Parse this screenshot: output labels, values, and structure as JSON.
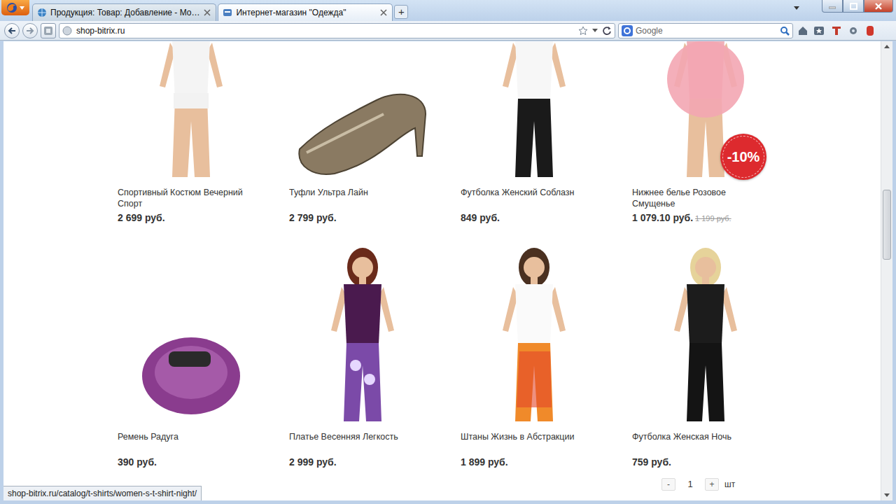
{
  "tabs": [
    {
      "label": "Продукция: Товар: Добавление - Мо…",
      "selected": false
    },
    {
      "label": "Интернет-магазин \"Одежда\"",
      "selected": true
    }
  ],
  "new_tab": "+",
  "address": "shop-bitrix.ru",
  "search": {
    "placeholder": "Google"
  },
  "products": [
    {
      "name": "Спортивный Костюм Вечерний Спорт",
      "price": "2 699 руб.",
      "old_price": "",
      "badge": ""
    },
    {
      "name": "Туфли Ультра Лайн",
      "price": "2 799 руб.",
      "old_price": "",
      "badge": ""
    },
    {
      "name": "Футболка Женский Соблазн",
      "price": "849 руб.",
      "old_price": "",
      "badge": ""
    },
    {
      "name": "Нижнее белье Розовое Смущенье",
      "price": "1 079.10 руб.",
      "old_price": "1 199 руб.",
      "badge": "-10%"
    },
    {
      "name": "Ремень Радуга",
      "price": "390 руб.",
      "old_price": "",
      "badge": ""
    },
    {
      "name": "Платье Весенняя Легкость",
      "price": "2 999 руб.",
      "old_price": "",
      "badge": ""
    },
    {
      "name": "Штаны Жизнь в Абстракции",
      "price": "1 899 руб.",
      "old_price": "",
      "badge": ""
    },
    {
      "name": "Футболка Женская Ночь",
      "price": "759 руб.",
      "old_price": "",
      "badge": ""
    }
  ],
  "quantity": {
    "minus": "-",
    "value": "1",
    "plus": "+",
    "unit": "шт"
  },
  "status_bar": {
    "url": "shop-bitrix.ru/catalog/t-shirts/women-s-t-shirt-night/"
  }
}
